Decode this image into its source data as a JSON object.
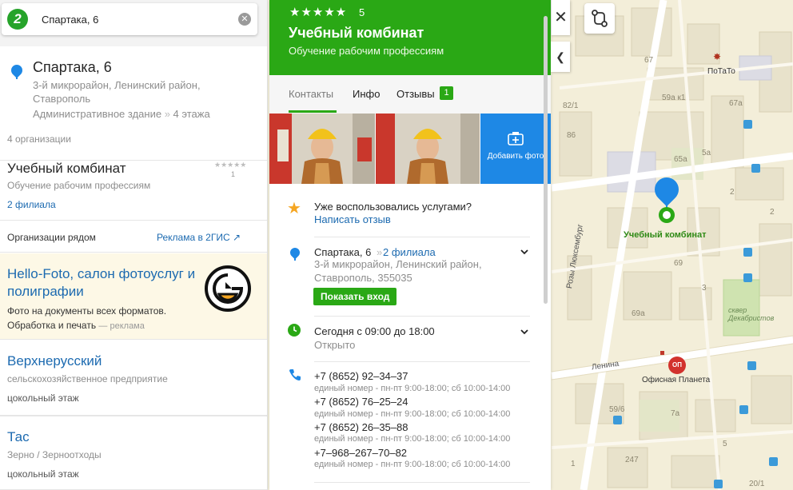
{
  "search": {
    "value": "Спартака, 6",
    "clear_icon": "close-icon"
  },
  "address": {
    "title": "Спартака, 6",
    "subtitle": "3-й микрорайон, Ленинский район, Ставрополь",
    "building": "Административное здание",
    "floors": "4 этажа",
    "orgs_count": "4 организации"
  },
  "org_list": {
    "first": {
      "name": "Учебный комбинат",
      "category": "Обучение рабочим профессиям",
      "branches": "2 филиала",
      "stars": "★★★★★",
      "reviews": "1"
    },
    "nearby_label": "Организации рядом",
    "nearby_ad_link": "Реклама в 2ГИС ↗",
    "ad": {
      "title": "Hello-Foto, салон фотоуслуг и полиграфии",
      "desc": "Фото на документы всех форматов. Обработка и печать",
      "ad_tag": "— реклама"
    },
    "items": [
      {
        "name": "Верхнерусский",
        "category": "сельскохозяйственное предприятие",
        "floor": "цокольный этаж"
      },
      {
        "name": "Тас",
        "category": "Зерно / Зерноотходы",
        "floor": "цокольный этаж"
      }
    ]
  },
  "card": {
    "stars": "★★★★★",
    "rating": "5",
    "title": "Учебный комбинат",
    "subtitle": "Обучение рабочим профессиям",
    "tabs": [
      {
        "label": "Контакты"
      },
      {
        "label": "Инфо"
      },
      {
        "label": "Отзывы"
      }
    ],
    "reviews_count": "1",
    "add_photo": "Добавить фото",
    "review_prompt": "Уже воспользовались услугами?",
    "review_link": "Написать отзыв",
    "address": "Спартака, 6",
    "address_branches": "2 филиала",
    "address_detail": "3-й микрорайон, Ленинский район, Ставрополь, 355035",
    "show_entrance": "Показать вход",
    "hours": "Сегодня с 09:00 до 18:00",
    "hours_status": "Открыто",
    "phones": [
      {
        "number": "+7 (8652) 92–34–37",
        "note": "единый номер - пн-пт 9:00-18:00; сб 10:00-14:00"
      },
      {
        "number": "+7 (8652) 76–25–24",
        "note": "единый номер - пн-пт 9:00-18:00; сб 10:00-14:00"
      },
      {
        "number": "+7 (8652) 26–35–88",
        "note": "единый номер - пн-пт 9:00-18:00; сб 10:00-14:00"
      },
      {
        "number": "+7–968–267–70–82",
        "note": "единый номер - пн-пт 9:00-18:00; сб 10:00-14:00"
      }
    ]
  },
  "map": {
    "labels": {
      "potato": "ПоТаТо",
      "ucheb": "Учебный комбинат",
      "office": "Офисная Планета",
      "office_badge": "ОП",
      "street_luxemburg": "Розы Люксембург",
      "street_lenina": "Ленина",
      "park": "сквер Декабристов",
      "n_82_1": "82/1",
      "n_86": "86",
      "n_59a_k1": "59а к1",
      "n_67a": "67а",
      "n_65a": "65а",
      "n_5a": "5а",
      "n_2": "2",
      "n_67": "67",
      "n_69": "69",
      "n_69a": "69а",
      "n_3": "3",
      "n_59_6": "59/6",
      "n_7a": "7а",
      "n_5": "5",
      "n_247": "247",
      "n_20_1": "20/1",
      "n_2b": "2",
      "n_1": "1"
    }
  },
  "colors": {
    "brand_green": "#2aa815",
    "link_blue": "#1c6ab0",
    "pin_blue": "#1e88e5",
    "map_bg": "#f3eed9"
  }
}
